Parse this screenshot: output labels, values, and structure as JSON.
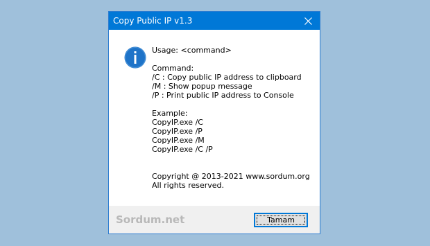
{
  "window": {
    "title": "Copy Public IP v1.3",
    "close_icon": "close-icon"
  },
  "message": {
    "icon": "info-icon",
    "lines": [
      "Usage: <command>",
      "",
      "Command:",
      "/C : Copy public IP address to clipboard",
      "/M : Show popup message",
      "/P : Print public IP address to Console",
      "",
      "Example:",
      "CopyIP.exe /C",
      "CopyIP.exe /P",
      "CopyIP.exe /M",
      "CopyIP.exe /C /P",
      "",
      "",
      "Copyright @ 2013-2021 www.sordum.org",
      "All rights reserved."
    ]
  },
  "footer": {
    "brand": "Sordum.net",
    "ok_label": "Tamam"
  },
  "colors": {
    "desktop": "#9fc0db",
    "titlebar": "#0078d7",
    "accent": "#1e73c8"
  }
}
